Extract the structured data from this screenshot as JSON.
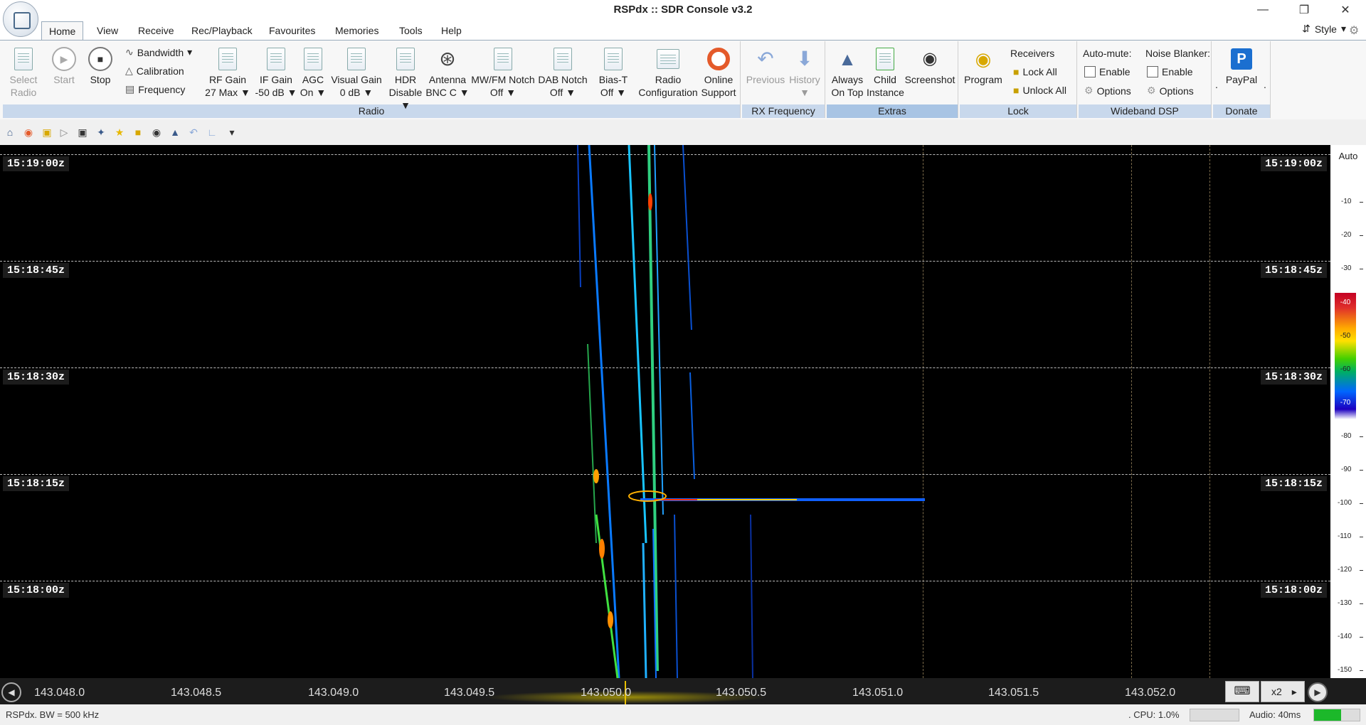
{
  "window": {
    "title": "RSPdx :: SDR Console v3.2"
  },
  "menu": {
    "tabs": [
      "Home",
      "View",
      "Receive",
      "Rec/Playback",
      "Favourites",
      "Memories",
      "Tools",
      "Help"
    ],
    "style_label": "Style"
  },
  "ribbon": {
    "select_radio": "Select Radio",
    "start": "Start",
    "stop": "Stop",
    "bandwidth": "Bandwidth",
    "calibration": "Calibration",
    "frequency": "Frequency",
    "rf_gain": {
      "label": "RF Gain",
      "value": "27 Max"
    },
    "if_gain": {
      "label": "IF Gain",
      "value": "-50 dB"
    },
    "agc": {
      "label": "AGC",
      "value": "On"
    },
    "visual_gain": {
      "label": "Visual Gain",
      "value": "0 dB"
    },
    "hdr": {
      "label": "HDR",
      "value": "Disable"
    },
    "antenna": {
      "label": "Antenna",
      "value": "BNC C"
    },
    "mwfm_notch": {
      "label": "MW/FM Notch",
      "value": "Off"
    },
    "dab_notch": {
      "label": "DAB Notch",
      "value": "Off"
    },
    "bias_t": {
      "label": "Bias-T",
      "value": "Off"
    },
    "radio_config": {
      "line1": "Radio",
      "line2": "Configuration"
    },
    "online_support": {
      "line1": "Online",
      "line2": "Support"
    },
    "group_radio": "Radio",
    "previous": "Previous",
    "history": "History",
    "group_rx": "RX Frequency",
    "always_on_top": {
      "line1": "Always",
      "line2": "On Top"
    },
    "child_instance": {
      "line1": "Child",
      "line2": "Instance"
    },
    "screenshot": "Screenshot",
    "group_extras": "Extras",
    "program": "Program",
    "receivers": "Receivers",
    "lock_all": "Lock All",
    "unlock_all": "Unlock All",
    "group_lock": "Lock",
    "auto_mute": "Auto-mute:",
    "enable1": "Enable",
    "options1": "Options",
    "noise_blanker": "Noise Blanker:",
    "enable2": "Enable",
    "options2": "Options",
    "group_dsp": "Wideband DSP",
    "paypal": "PayPal",
    "group_donate": "Donate",
    "dot": "."
  },
  "waterfall": {
    "times": [
      "15:19:00z",
      "15:18:45z",
      "15:18:30z",
      "15:18:15z",
      "15:18:00z"
    ],
    "scale_mode": "Auto",
    "scale_ticks": [
      "-10",
      "-20",
      "-30",
      "-40",
      "-50",
      "-60",
      "-70",
      "-80",
      "-90",
      "-100",
      "-110",
      "-120",
      "-130",
      "-140",
      "-150"
    ]
  },
  "frequency_axis": {
    "labels": [
      "143.048.0",
      "143.048.5",
      "143.049.0",
      "143.049.5",
      "143.050.0",
      "143.050.5",
      "143.051.0",
      "143.051.5",
      "143.052.0"
    ],
    "zoom": "x2"
  },
  "status": {
    "left": "RSPdx. BW = 500 kHz",
    "cpu": ". CPU: 1.0%",
    "audio": "Audio: 40ms"
  }
}
